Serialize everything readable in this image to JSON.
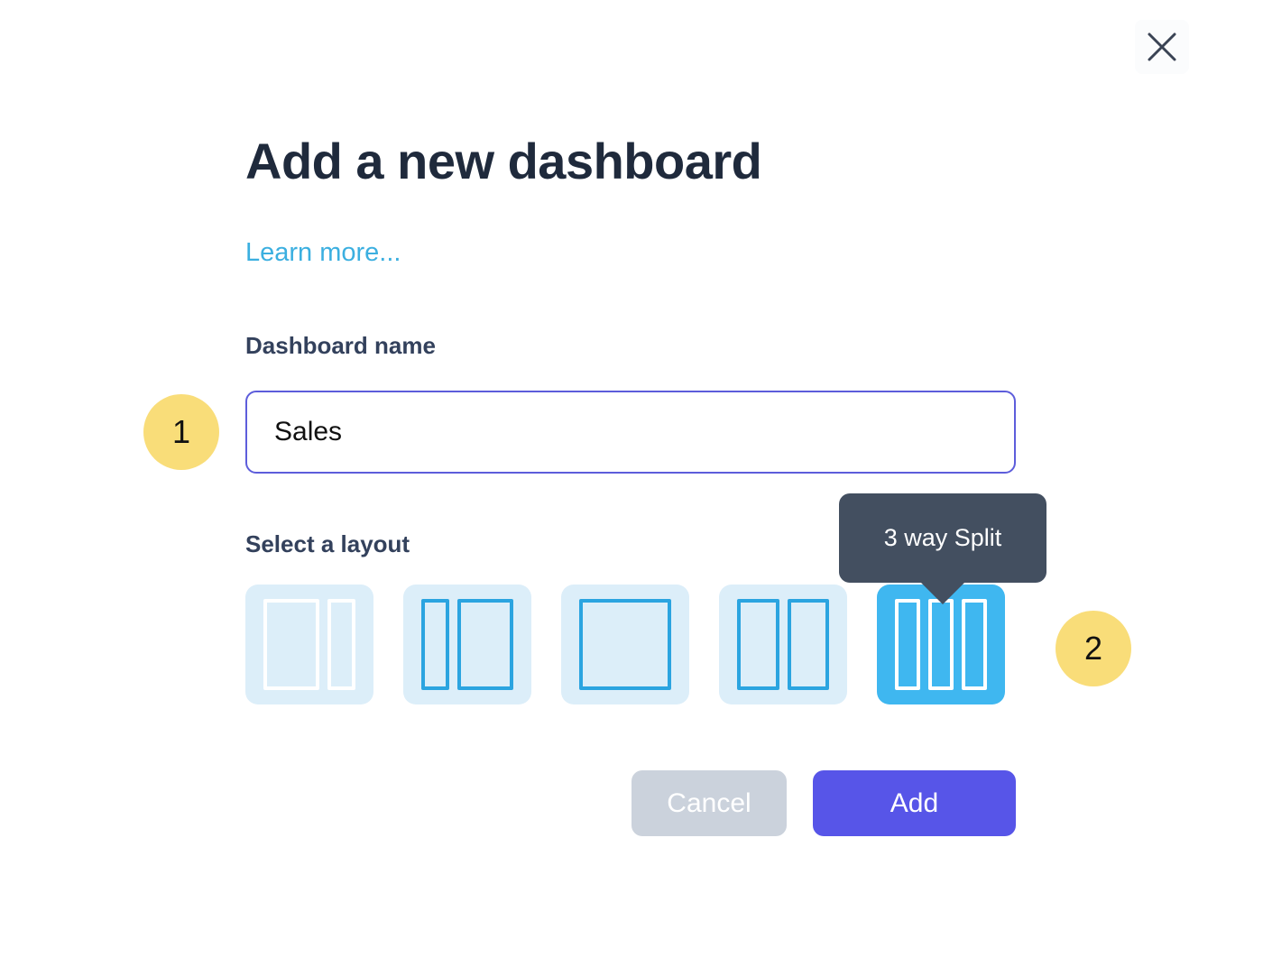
{
  "dialog": {
    "title": "Add a new dashboard",
    "learn_more_label": "Learn more...",
    "close_icon": "close-icon"
  },
  "name_field": {
    "label": "Dashboard name",
    "value": "Sales",
    "placeholder": "Dashboard name",
    "border_color": "#5D5DDB"
  },
  "layout_field": {
    "label": "Select a layout",
    "tiles": [
      {
        "name": "main-with-sidebar",
        "panes": 2,
        "selected": false,
        "stroke": "white"
      },
      {
        "name": "sidebar-with-main",
        "panes": 2,
        "selected": false,
        "stroke": "blue"
      },
      {
        "name": "single-pane",
        "panes": 1,
        "selected": false,
        "stroke": "blue"
      },
      {
        "name": "2-way-split",
        "panes": 2,
        "selected": false,
        "stroke": "blue"
      },
      {
        "name": "3-way-split",
        "panes": 3,
        "selected": true,
        "stroke": "white"
      }
    ],
    "selected_index": 4,
    "tile_color": "#DCEEF9",
    "selected_color": "#3FB7F0"
  },
  "tooltip": {
    "text": "3 way Split",
    "background": "#434F60"
  },
  "badges": [
    {
      "name": "step-badge-1",
      "label": "1",
      "color": "#F9DD79"
    },
    {
      "name": "step-badge-2",
      "label": "2",
      "color": "#F9DD79"
    }
  ],
  "footer": {
    "cancel_label": "Cancel",
    "cancel_color": "#CBD2DC",
    "add_label": "Add",
    "add_color": "#5755E8"
  }
}
